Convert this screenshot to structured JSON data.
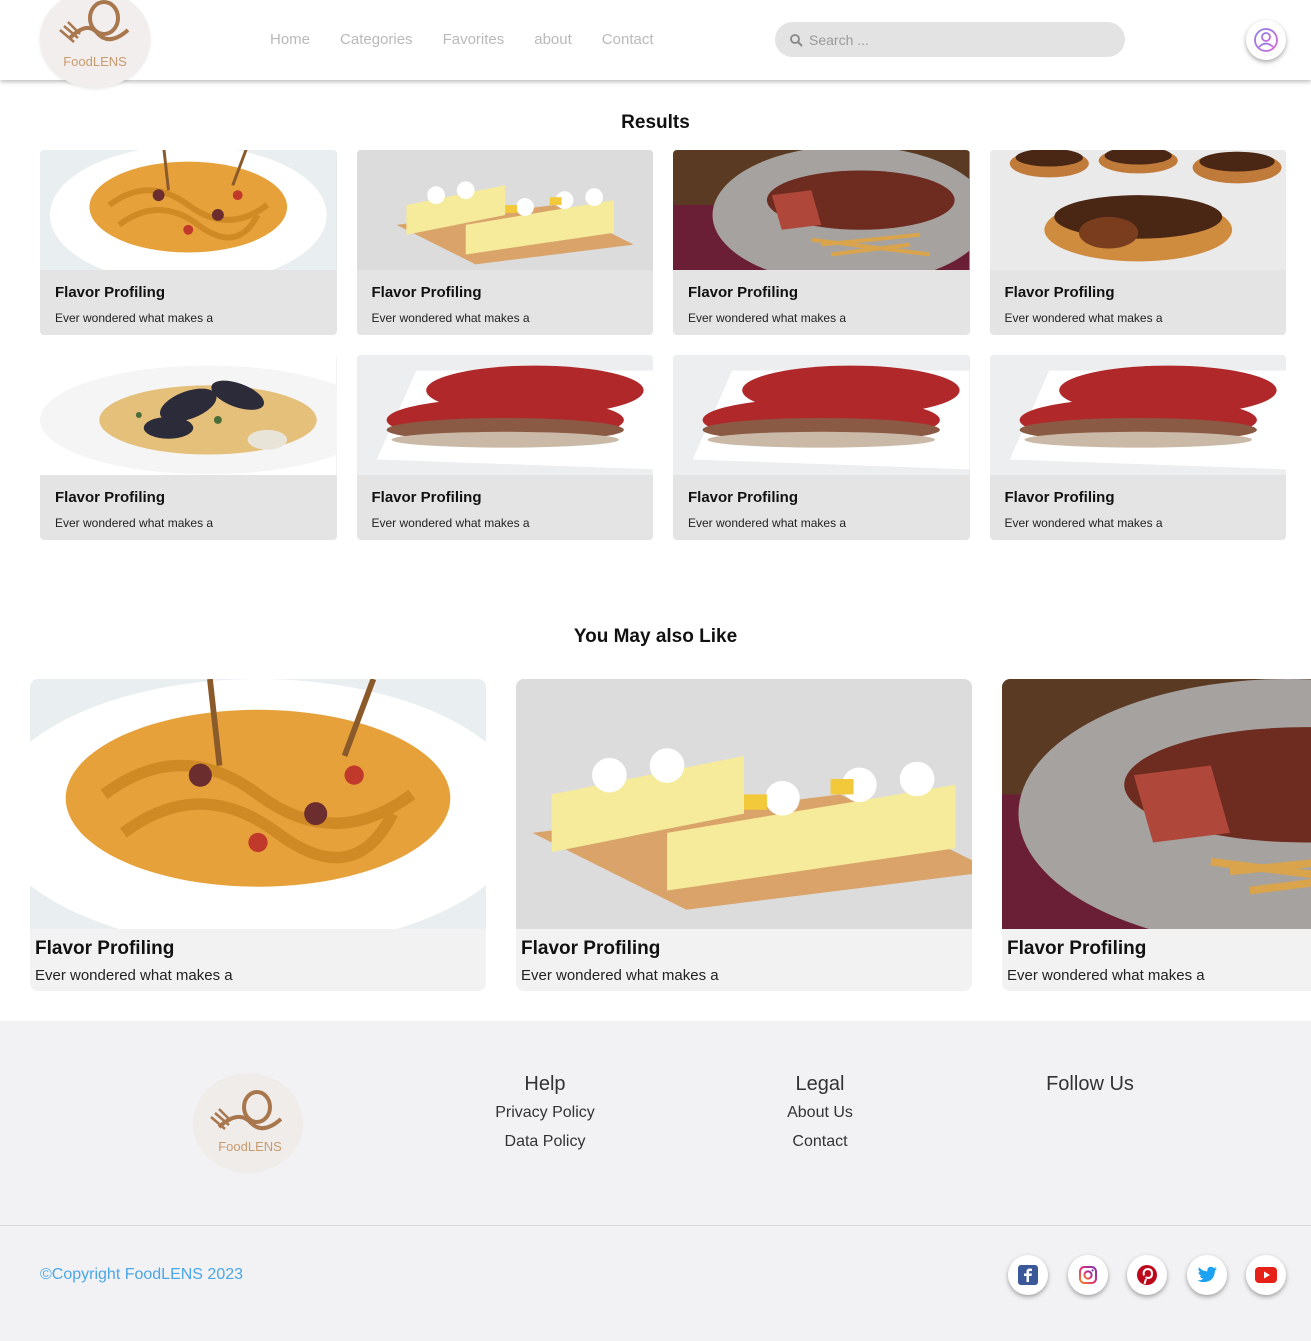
{
  "header": {
    "logo_text": "FoodLENS",
    "nav": [
      "Home",
      "Categories",
      "Favorites",
      "about",
      "Contact"
    ],
    "search_placeholder": "Search ..."
  },
  "results": {
    "title": "Results",
    "cards": [
      {
        "title": "Flavor Profiling",
        "desc": "Ever wondered what makes a",
        "image": "pasta"
      },
      {
        "title": "Flavor Profiling",
        "desc": "Ever wondered what makes a",
        "image": "cake"
      },
      {
        "title": "Flavor Profiling",
        "desc": "Ever wondered what makes a",
        "image": "steak"
      },
      {
        "title": "Flavor Profiling",
        "desc": "Ever wondered what makes a",
        "image": "tart"
      },
      {
        "title": "Flavor Profiling",
        "desc": "Ever wondered what makes a",
        "image": "mussels"
      },
      {
        "title": "Flavor Profiling",
        "desc": "Ever wondered what makes a",
        "image": "meatloaf"
      },
      {
        "title": "Flavor Profiling",
        "desc": "Ever wondered what makes a",
        "image": "meatloaf"
      },
      {
        "title": "Flavor Profiling",
        "desc": "Ever wondered what makes a",
        "image": "meatloaf"
      }
    ]
  },
  "also_like": {
    "title": "You May also Like",
    "cards": [
      {
        "title": "Flavor Profiling",
        "desc": "Ever wondered what makes a",
        "image": "pasta"
      },
      {
        "title": "Flavor Profiling",
        "desc": "Ever wondered what makes a",
        "image": "cake"
      },
      {
        "title": "Flavor Profiling",
        "desc": "Ever wondered what makes a",
        "image": "steak"
      }
    ]
  },
  "footer": {
    "logo_text": "FoodLENS",
    "help": {
      "heading": "Help",
      "links": [
        "Privacy Policy",
        "Data Policy"
      ]
    },
    "legal": {
      "heading": "Legal",
      "links": [
        "About Us",
        "Contact"
      ]
    },
    "follow_heading": "Follow Us",
    "copyright": "©Copyright FoodLENS 2023",
    "social": [
      "facebook-icon",
      "instagram-icon",
      "pinterest-icon",
      "twitter-icon",
      "youtube-icon"
    ]
  },
  "colors": {
    "brand": "#a8774e",
    "copyright": "#4aa6e8",
    "card_bg": "#e4e4e4"
  }
}
